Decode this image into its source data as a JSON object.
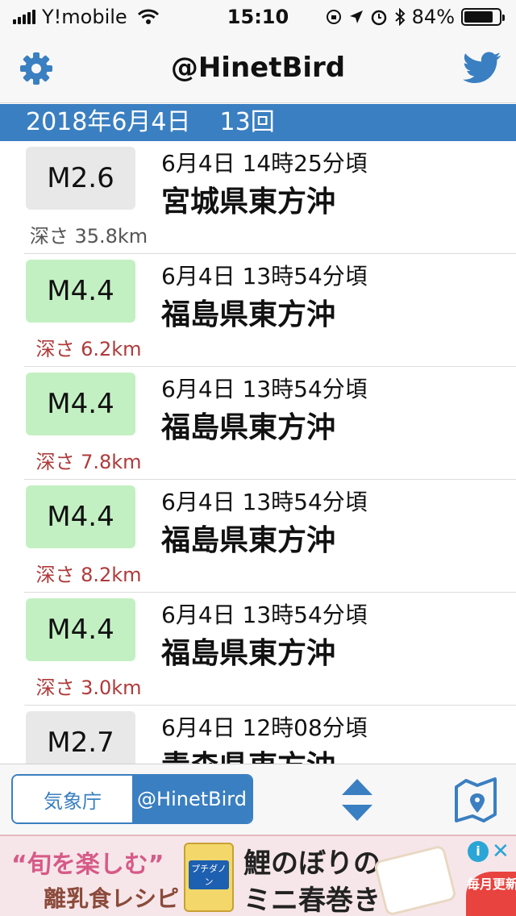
{
  "status_bar": {
    "carrier": "Y!mobile",
    "time": "15:10",
    "battery": "84%",
    "battery_level": 0.84,
    "icons": [
      "signal-bars-icon",
      "wifi-icon",
      "orientation-lock-icon",
      "location-icon",
      "alarm-icon",
      "bluetooth-icon",
      "battery-icon"
    ]
  },
  "nav": {
    "title": "@HinetBird",
    "left_icon": "gear-icon",
    "right_icon": "twitter-icon"
  },
  "date_header": {
    "date": "2018年6月4日",
    "count": "13回"
  },
  "quakes": [
    {
      "magnitude": "M2.6",
      "depth": "深さ 35.8km",
      "time": "6月4日 14時25分頃",
      "place": "宮城県東方沖",
      "level": "small"
    },
    {
      "magnitude": "M4.4",
      "depth": "深さ 6.2km",
      "time": "6月4日 13時54分頃",
      "place": "福島県東方沖",
      "level": "mid"
    },
    {
      "magnitude": "M4.4",
      "depth": "深さ 7.8km",
      "time": "6月4日 13時54分頃",
      "place": "福島県東方沖",
      "level": "mid"
    },
    {
      "magnitude": "M4.4",
      "depth": "深さ 8.2km",
      "time": "6月4日 13時54分頃",
      "place": "福島県東方沖",
      "level": "mid"
    },
    {
      "magnitude": "M4.4",
      "depth": "深さ 3.0km",
      "time": "6月4日 13時54分頃",
      "place": "福島県東方沖",
      "level": "mid"
    },
    {
      "magnitude": "M2.7",
      "depth": "",
      "time": "6月4日 12時08分頃",
      "place": "青森県東方沖",
      "level": "small"
    }
  ],
  "toolbar": {
    "segments": [
      "気象庁",
      "@HinetBird"
    ],
    "selected_segment": "@HinetBird",
    "sort_icon": "sort-up-down-icon",
    "map_icon": "map-pin-icon"
  },
  "ad": {
    "line1": "“旬を楽しむ”",
    "line2": "離乳食レシピ",
    "can_label": "プチダノン",
    "headline1": "鯉のぼりの",
    "headline2": "ミニ春巻き",
    "badge": "毎月更新",
    "info_icon": "info-icon",
    "close_icon": "close-icon"
  },
  "colors": {
    "accent": "#3a7fc1",
    "small_mag_bg": "#e8e8e8",
    "mid_mag_bg": "#c3f0c3",
    "depth_red": "#b03a3a",
    "depth_gray": "#555555"
  }
}
